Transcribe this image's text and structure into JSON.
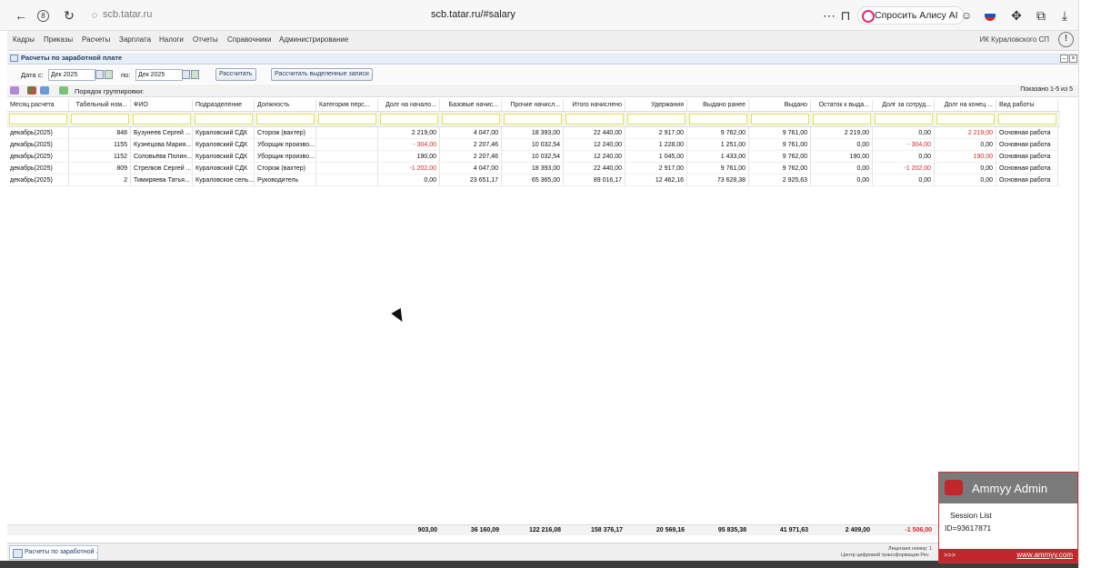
{
  "browser": {
    "url_short": "scb.tatar.ru",
    "url_full": "scb.tatar.ru/#salary",
    "alice_label": "Спросить Алису AI"
  },
  "menu": {
    "items": [
      "Кадры",
      "Приказы",
      "Расчеты",
      "Зарплата",
      "Налоги",
      "Отчеты",
      "Справочники",
      "Администрирование"
    ],
    "org": "ИК Кураловского СП"
  },
  "panel": {
    "title": "Расчеты по заработной плате"
  },
  "filters": {
    "date_from_label": "Дата с:",
    "date_from": "Дек 2025",
    "date_to_label": "по:",
    "date_to": "Дек 2025",
    "calc_button": "Рассчитать",
    "calc_selected_button": "Рассчитать выделенные записи"
  },
  "toolbar": {
    "grouping_label": "Порядок группировки:",
    "shown": "Показано 1-5 из 5"
  },
  "table": {
    "columns": [
      "Месяц расчета",
      "Табельный ном...",
      "ФИО",
      "Подразделение",
      "Должность",
      "Категория перс...",
      "Долг на начало...",
      "Базовые начис...",
      "Прочие начисл...",
      "Итого начислено",
      "Удержания",
      "Выдано ранее",
      "Выдано",
      "Остаток к выда...",
      "Долг за сотруд...",
      "Долг на конец ...",
      "Вид работы"
    ],
    "rows": [
      [
        "декабрь(2025)",
        "848",
        "Бузунеев Сергей ...",
        "Кураловский СДК",
        "Сторож (вахтер)",
        "",
        "2 219,00",
        "4 047,00",
        "18 393,00",
        "22 440,00",
        "2 917,00",
        "9 762,00",
        "9 761,00",
        "2 219,00",
        "0,00",
        "2 219,00",
        "Основная работа"
      ],
      [
        "декабрь(2025)",
        "1155",
        "Кузнецова Мария...",
        "Кураловский СДК",
        "Уборщик произво...",
        "",
        "- 304,00",
        "2 207,46",
        "10 032,54",
        "12 240,00",
        "1 228,00",
        "1 251,00",
        "9 761,00",
        "0,00",
        "- 304,00",
        "0,00",
        "Основная работа"
      ],
      [
        "декабрь(2025)",
        "1152",
        "Соловьёва Полин...",
        "Кураловский СДК",
        "Уборщик произво...",
        "",
        "190,00",
        "2 207,46",
        "10 032,54",
        "12 240,00",
        "1 045,00",
        "1 433,00",
        "9 762,00",
        "190,00",
        "0,00",
        "190,00",
        "Основная работа"
      ],
      [
        "декабрь(2025)",
        "809",
        "Стрелков Сергей ...",
        "Кураловский СДК",
        "Сторож (вахтер)",
        "",
        "-1 202,00",
        "4 047,00",
        "18 393,00",
        "22 440,00",
        "2 917,00",
        "9 761,00",
        "9 762,00",
        "0,00",
        "-1 202,00",
        "0,00",
        "Основная работа"
      ],
      [
        "декабрь(2025)",
        "2",
        "Тимиряева Татья...",
        "Кураловское сель...",
        "Руководитель",
        "",
        "0,00",
        "23 651,17",
        "65 365,00",
        "89 016,17",
        "12 462,16",
        "73 628,38",
        "2 925,63",
        "0,00",
        "0,00",
        "0,00",
        "Основная работа"
      ]
    ],
    "totals": [
      "903,00",
      "36 160,09",
      "122 216,08",
      "158 376,17",
      "20 569,16",
      "95 835,38",
      "41 971,63",
      "2 409,00",
      "-1 506,00"
    ]
  },
  "taskbar": {
    "item": "Расчеты по заработной ...",
    "license": "Лицензия номер: 1",
    "center": "Центр цифровой трансформации Рес"
  },
  "ammyy": {
    "title": "Ammyy Admin",
    "session_list": "Session List",
    "id": "ID=93617871",
    "more": ">>>",
    "link": "www.ammyy.com"
  },
  "colors": {
    "negative": "#e02424",
    "ammyy_red": "#c0282d",
    "filter_border": "#e8e24a"
  }
}
